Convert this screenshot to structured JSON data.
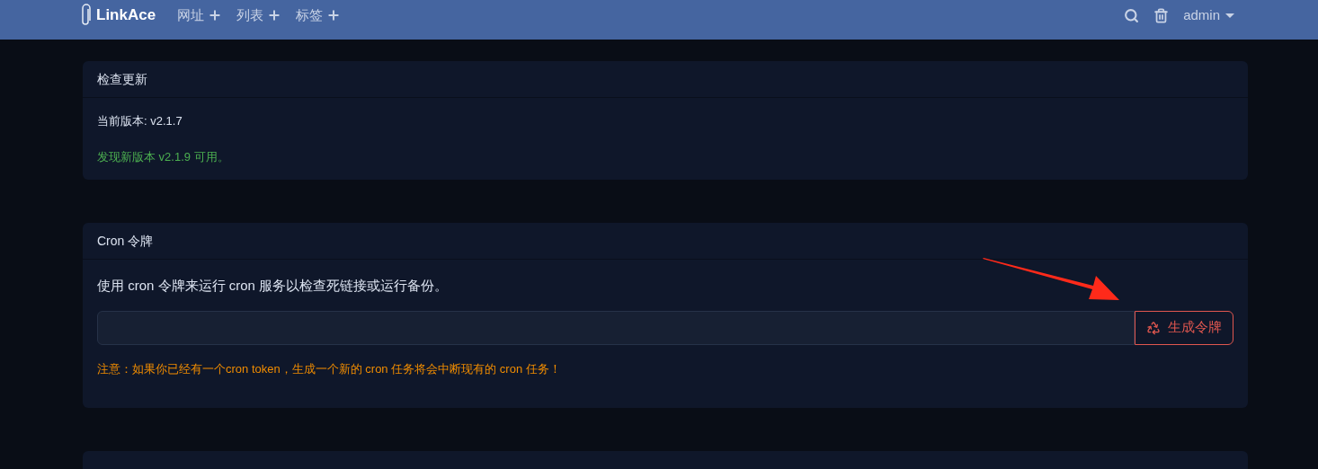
{
  "navbar": {
    "brand": "LinkAce",
    "menu": [
      {
        "label": "网址"
      },
      {
        "label": "列表"
      },
      {
        "label": "标签"
      }
    ],
    "user": "admin"
  },
  "update_card": {
    "title": "检查更新",
    "current_version": "当前版本: v2.1.7",
    "new_version": "发现新版本 v2.1.9 可用。"
  },
  "cron_card": {
    "title": "Cron 令牌",
    "description": "使用 cron 令牌来运行 cron 服务以检查死链接或运行备份。",
    "button": "生成令牌",
    "warning": "注意：如果你已经有一个cron token，生成一个新的 cron 任务将会中断现有的 cron 任务！"
  }
}
